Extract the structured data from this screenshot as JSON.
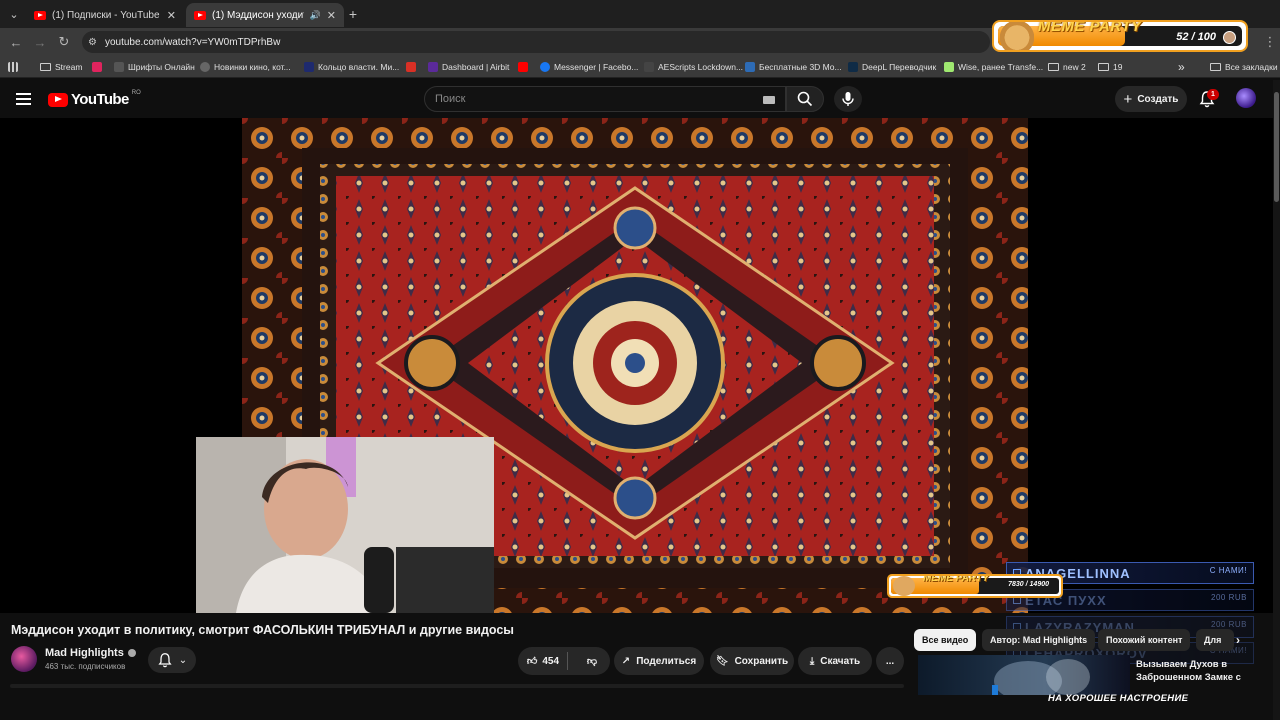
{
  "browser": {
    "tabs": [
      {
        "title": "(1) Подписки - YouTube",
        "active": false
      },
      {
        "title": "(1) Мэддисон уходит в поли",
        "active": true
      }
    ],
    "new_tab": "+",
    "url": "youtube.com/watch?v=YW0mTDPrhBw",
    "bookmarks": [
      {
        "label": "Stream",
        "icon": "folder-icon"
      },
      {
        "label": "",
        "icon": "red-square-icon"
      },
      {
        "label": "Шрифты Онлайн",
        "icon": "font-icon"
      },
      {
        "label": "Новинки кино, кот...",
        "icon": "film-icon"
      },
      {
        "label": "Кольцо власти. Ми...",
        "icon": "r-icon"
      },
      {
        "label": "",
        "icon": "gmail-icon"
      },
      {
        "label": "Dashboard | Airbit",
        "icon": "airbit-icon"
      },
      {
        "label": "",
        "icon": "youtube-icon"
      },
      {
        "label": "Messenger | Facebo...",
        "icon": "facebook-icon"
      },
      {
        "label": "AEScripts Lockdown...",
        "icon": "aescripts-icon"
      },
      {
        "label": "Бесплатные 3D Mo...",
        "icon": "3d-icon"
      },
      {
        "label": "DeepL Переводчик",
        "icon": "deepl-icon"
      },
      {
        "label": "Wise, ранее Transfe...",
        "icon": "wise-icon"
      },
      {
        "label": "new 2",
        "icon": "folder-icon"
      },
      {
        "label": "19",
        "icon": "folder-icon"
      }
    ],
    "all_bookmarks": "Все закладки",
    "more": "»"
  },
  "meme_widget": {
    "title": "MEME PARTY",
    "count": "52 / 100",
    "progress": 0.52
  },
  "youtube": {
    "logo": "YouTube",
    "region": "RO",
    "search_placeholder": "Поиск",
    "create_label": "Создать",
    "notifications": "1"
  },
  "stream_overlay": {
    "mini_title": "MEME PARTY",
    "mini_count": "7830 / 14900",
    "mini_progress": 0.525,
    "chat": [
      {
        "name": "ANAGELLINNA",
        "tag": "С НАМИ!"
      },
      {
        "name": "ЕТАС ПУХХ",
        "tag": "200 RUB"
      },
      {
        "name": "LAZYRAZYMAN",
        "tag": "200 RUB"
      },
      {
        "name": "LEHAPROXOROV",
        "tag": "С НАМИ!"
      }
    ],
    "bottom_caption": "НА ХОРОШЕЕ НАСТРОЕНИЕ"
  },
  "video": {
    "title": "Мэддисон уходит в политику, смотрит ФАСОЛЬКИН ТРИБУНАЛ и другие видосы",
    "channel": "Mad Highlights",
    "subscribers": "463 тыс. подписчиков",
    "likes": "454",
    "share": "Поделиться",
    "save": "Сохранить",
    "download": "Скачать",
    "more": "..."
  },
  "chips": [
    {
      "label": "Все видео",
      "active": true
    },
    {
      "label": "Автор: Mad Highlights",
      "active": false
    },
    {
      "label": "Похожий контент",
      "active": false
    },
    {
      "label": "Для",
      "active": false
    }
  ],
  "recommendation": {
    "title": "Вызываем Духов в Заброшенном Замке с"
  },
  "colors": {
    "accent": "#ff0000",
    "background": "#0f0f0f",
    "meme_orange": "#f08a00",
    "chat_blue": "#3b5ab0"
  }
}
